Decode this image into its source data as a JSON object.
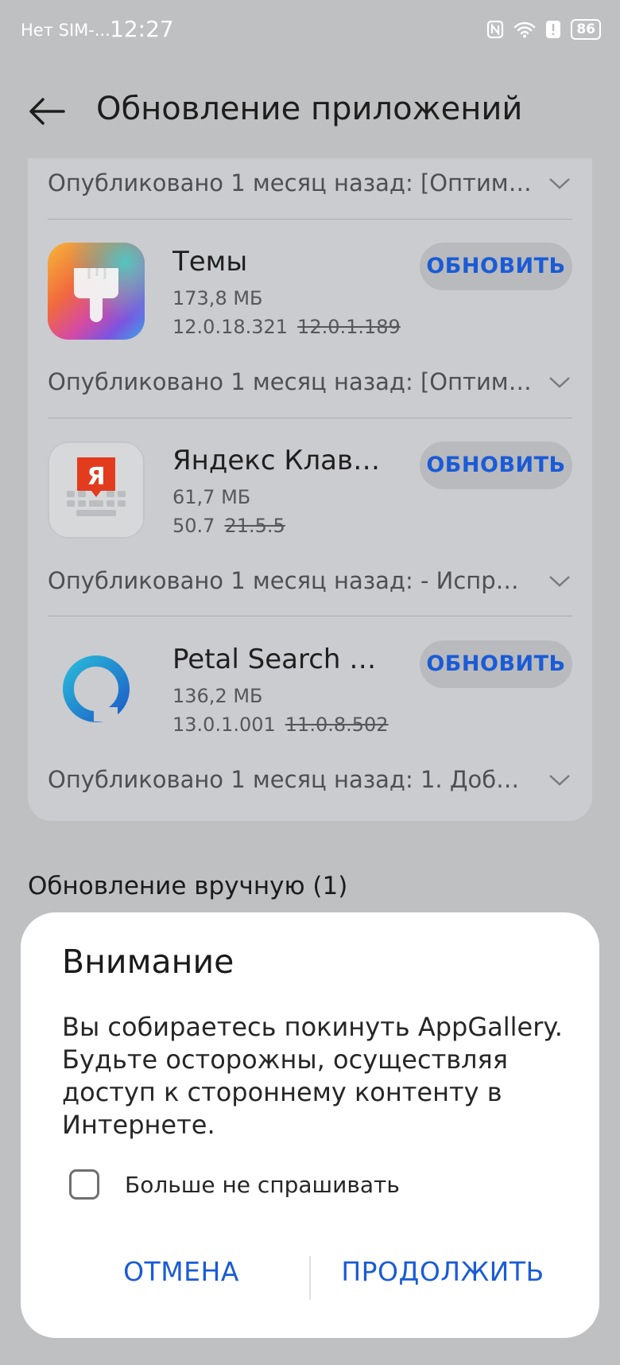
{
  "status_bar": {
    "carrier": "Нет SIM-...",
    "time": "12:27",
    "battery": "86"
  },
  "header": {
    "title": "Обновление приложений"
  },
  "updates": {
    "first_published": "Опубликовано 1 месяц назад: [Оптимиз...",
    "apps": [
      {
        "name": "Темы",
        "size": "173,8 МБ",
        "version_new": "12.0.18.321",
        "version_old": "12.0.1.189",
        "button": "ОБНОВИТЬ",
        "published": "Опубликовано 1 месяц назад: [Оптимиз..."
      },
      {
        "name": "Яндекс Клави...",
        "size": "61,7 МБ",
        "version_new": "50.7",
        "version_old": "21.5.5",
        "button": "ОБНОВИТЬ",
        "published": "Опубликовано 1 месяц назад: - Исправ...",
        "icon_letter": "Я"
      },
      {
        "name": "Petal Search -...",
        "size": "136,2 МБ",
        "version_new": "13.0.1.001",
        "version_old": "11.0.8.502",
        "button": "ОБНОВИТЬ",
        "published": "Опубликовано 1 месяц назад: 1. Добав..."
      }
    ]
  },
  "manual_section": {
    "title": "Обновление вручную (1)"
  },
  "dialog": {
    "title": "Внимание",
    "body": "Вы собираетесь покинуть AppGallery. Будьте осторожны, осуществляя доступ к стороннему контенту в Интернете.",
    "checkbox_label": "Больше не спрашивать",
    "cancel": "ОТМЕНА",
    "continue": "ПРОДОЛЖИТЬ"
  },
  "colors": {
    "accent": "#1a5bd6",
    "overlay_bg": "#bfc0c2",
    "card_bg": "#cbcccf"
  }
}
